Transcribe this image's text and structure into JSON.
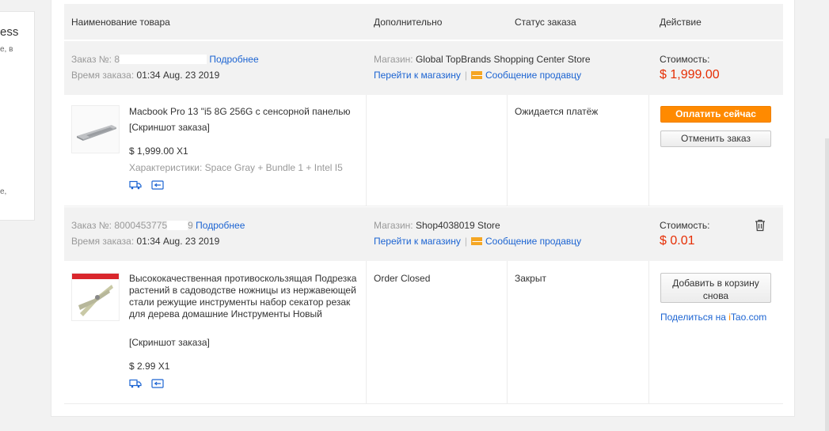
{
  "sidebar": {
    "title_fragment": "ess",
    "line1": "е, в",
    "line2": "е,"
  },
  "table_header": {
    "name": "Наименование товара",
    "extra": "Дополнительно",
    "status": "Статус заказа",
    "action": "Действие"
  },
  "orders": [
    {
      "order_label": "Заказ №:",
      "order_no_visible": "8",
      "details_link": "Подробнее",
      "time_label": "Время заказа:",
      "time_value": "01:34 Aug. 23 2019",
      "store_label": "Магазин:",
      "store_name": "Global TopBrands Shopping Center Store",
      "go_store": "Перейти к магазину",
      "message_seller": "Сообщение продавцу",
      "cost_label": "Стоимость:",
      "cost_value": "$ 1,999.00",
      "product_name": "Macbook Pro 13 \"i5 8G 256G с сенсорной панелью",
      "snapshot": "[Скриншот заказа]",
      "price_qty": "$ 1,999.00 X1",
      "specs": "Характеристики: Space Gray + Bundle 1 + Intel I5",
      "extra_info": "",
      "status": "Ожидается платёж",
      "btn_primary": "Оплатить сейчас",
      "btn_secondary": "Отменить заказ"
    },
    {
      "order_label": "Заказ №:",
      "order_no_visible": "8000453775",
      "order_no_tail": "9",
      "details_link": "Подробнее",
      "time_label": "Время заказа:",
      "time_value": "01:34 Aug. 23 2019",
      "store_label": "Магазин:",
      "store_name": "Shop4038019 Store",
      "go_store": "Перейти к магазину",
      "message_seller": "Сообщение продавцу",
      "cost_label": "Стоимость:",
      "cost_value": "$ 0.01",
      "product_name": "Высококачественная противоскользящая Подрезка растений в садоводстве ножницы из нержавеющей стали режущие инструменты набор секатор резак для дерева домашние Инструменты Новый",
      "snapshot": "[Скриншот заказа]",
      "price_qty": "$ 2.99 X1",
      "extra_info": "Order Closed",
      "status": "Закрыт",
      "btn_add_cart": "Добавить в корзину снова",
      "share_prefix": "Поделиться на ",
      "share_brand_i": "i",
      "share_brand_rest": "Tao.com"
    }
  ],
  "colors": {
    "accent_orange": "#ff8a00",
    "link_blue": "#1c64d2",
    "price_red": "#e62e04",
    "header_gray": "#f2f2f2"
  }
}
